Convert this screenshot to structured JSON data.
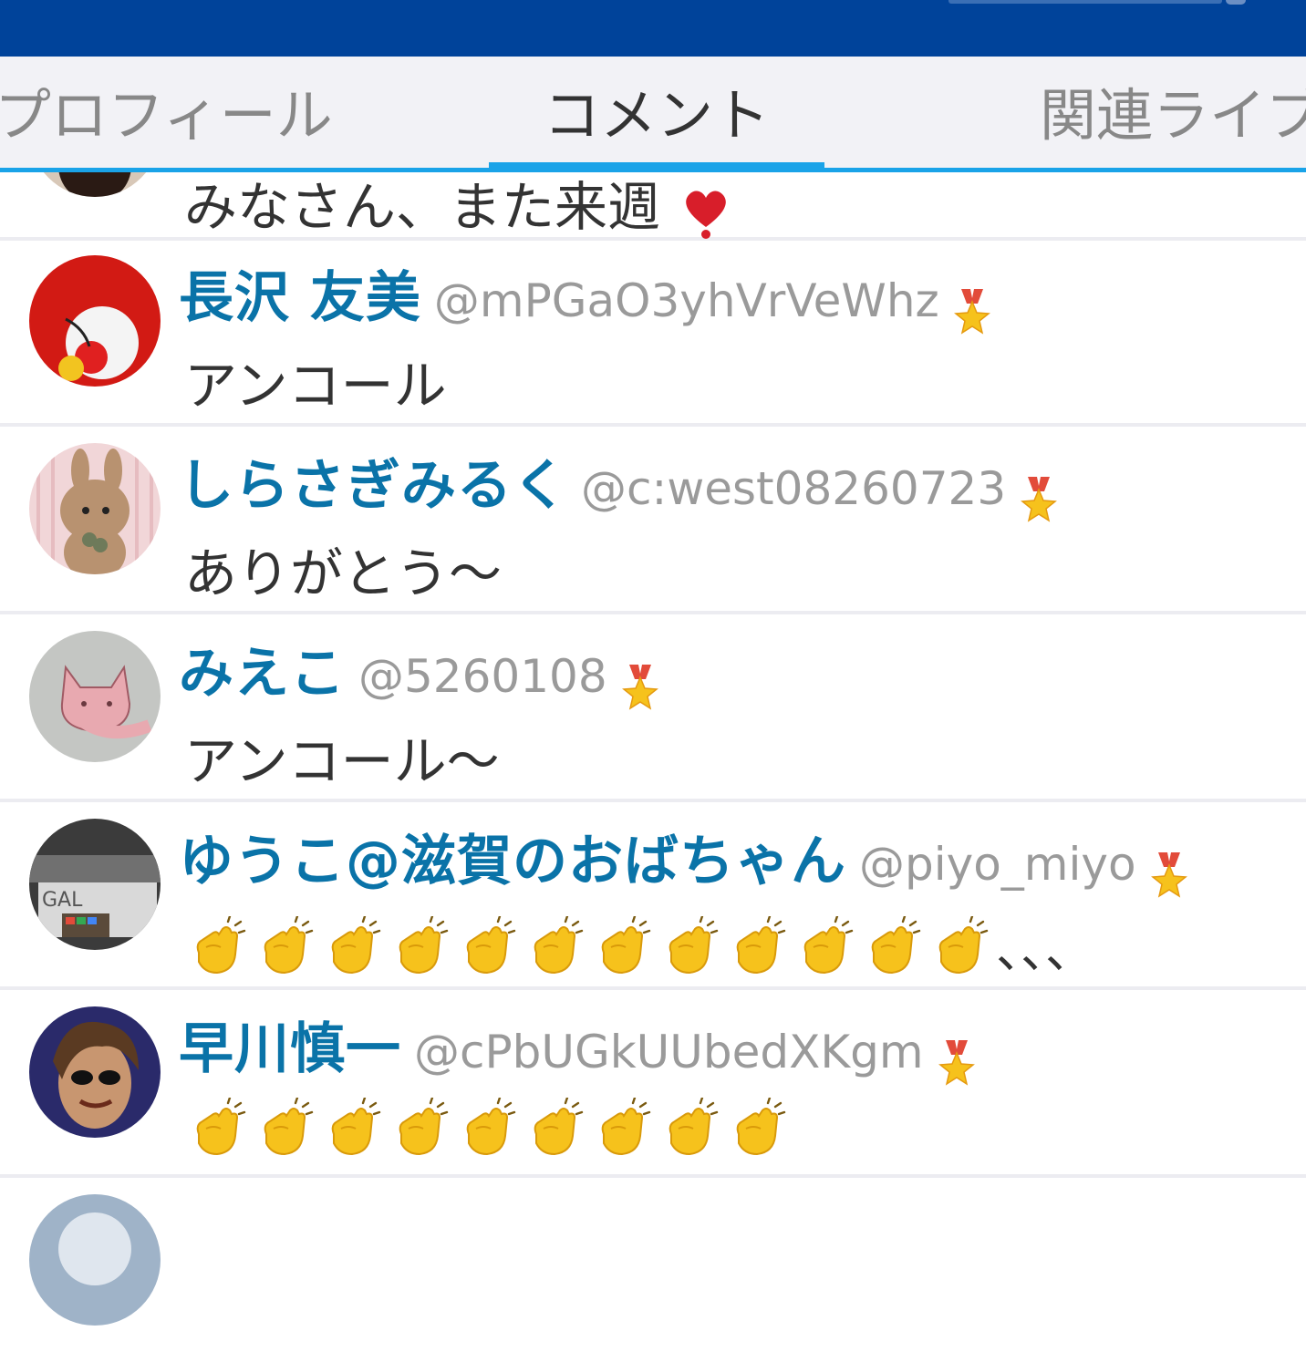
{
  "tabs": [
    {
      "label": "プロフィール",
      "active": false
    },
    {
      "label": "コメント",
      "active": true
    },
    {
      "label": "関連ライブ",
      "active": false
    }
  ],
  "comments": [
    {
      "message": "みなさん、また来週",
      "emoji": "balloon-heart"
    },
    {
      "name": "長沢 友美",
      "handle": "@mPGaO3yhVrVeWhz",
      "message": "アンコール",
      "avatar": "red-bowl"
    },
    {
      "name": "しらさぎみるく",
      "handle": "@c:west08260723",
      "message": "ありがとう〜",
      "avatar": "rabbit"
    },
    {
      "name": "みえこ",
      "handle": "@5260108",
      "message": "アンコール〜",
      "avatar": "cat"
    },
    {
      "name": "ゆうこ@滋賀のおばちゃん",
      "handle": "@piyo_miyo",
      "claps": 12,
      "message_tail": "、、、",
      "avatar": "studio"
    },
    {
      "name": "早川慎一",
      "handle": "@cPbUGkUUbedXKgm",
      "claps": 9,
      "avatar": "man"
    },
    {
      "name": "",
      "handle": "",
      "avatar": "partial"
    }
  ],
  "colors": {
    "header": "#00439a",
    "accent": "#1aa3e8",
    "username": "#0a73a8",
    "handle": "#9a9a9a"
  }
}
